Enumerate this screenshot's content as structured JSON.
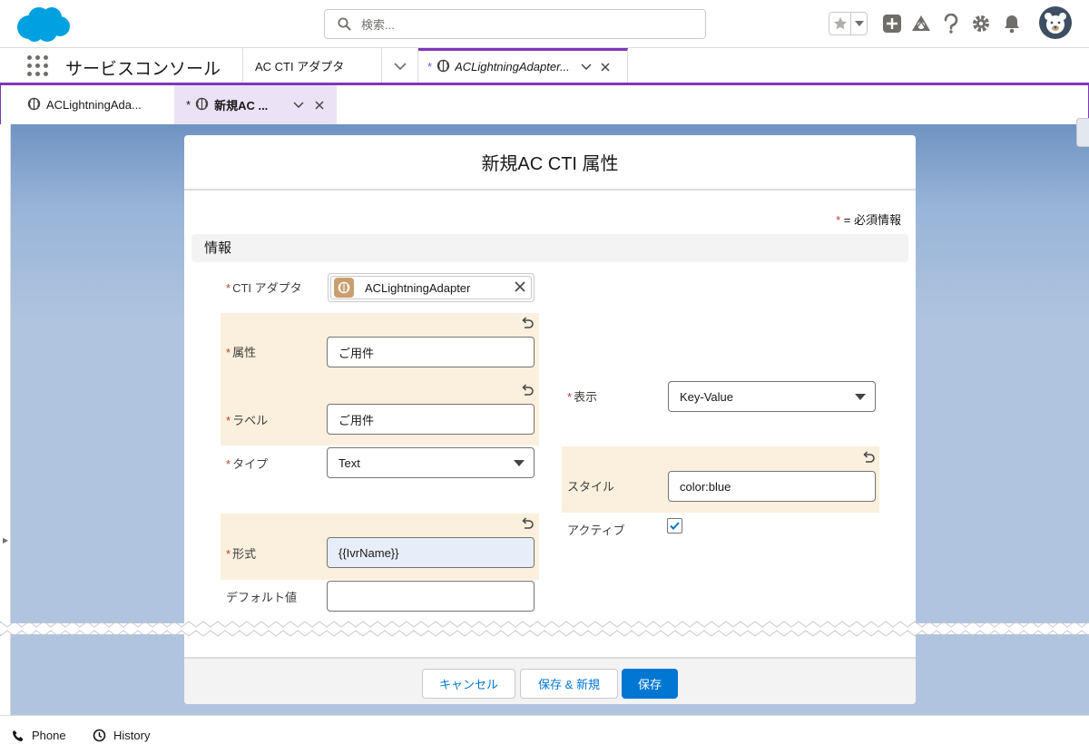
{
  "header": {
    "search_placeholder": "検索...",
    "icons": [
      "salesforce-cloud-logo",
      "search-icon",
      "star-icon",
      "chevron-down-icon",
      "plus-icon",
      "trailhead-icon",
      "help-icon",
      "gear-icon",
      "bell-icon",
      "avatar-bear"
    ]
  },
  "nav": {
    "app_name": "サービスコンソール",
    "tabs": [
      {
        "label": "AC CTI アダプタ"
      },
      {
        "modified": "*",
        "label": "ACLightningAdapter..."
      }
    ]
  },
  "subtabs": [
    {
      "label": "ACLightningAda..."
    },
    {
      "modified": "*",
      "label": "新規AC ..."
    }
  ],
  "modal": {
    "title": "新規AC CTI 属性",
    "required_legend": "= 必須情報",
    "required_mark": "*",
    "section_title": "情報",
    "fields": {
      "adapter": {
        "label": "CTI アダプタ",
        "value": "ACLightningAdapter"
      },
      "attribute": {
        "label": "属性",
        "value": "ご用件"
      },
      "field_label": {
        "label": "ラベル",
        "value": "ご用件"
      },
      "type": {
        "label": "タイプ",
        "value": "Text"
      },
      "format": {
        "label": "形式",
        "value": "{{IvrName}}"
      },
      "default_value": {
        "label": "デフォルト値",
        "value": ""
      },
      "display": {
        "label": "表示",
        "value": "Key-Value"
      },
      "style": {
        "label": "スタイル",
        "value": "color:blue"
      },
      "active": {
        "label": "アクティブ",
        "checked": true
      }
    },
    "buttons": {
      "cancel": "キャンセル",
      "save_new": "保存 & 新規",
      "save": "保存"
    }
  },
  "utility_bar": {
    "phone": "Phone",
    "history": "History"
  },
  "colors": {
    "brand_blue": "#0176d3",
    "nav_accent": "#7f36b8",
    "highlight": "#faf0dd",
    "required": "#c23934"
  }
}
